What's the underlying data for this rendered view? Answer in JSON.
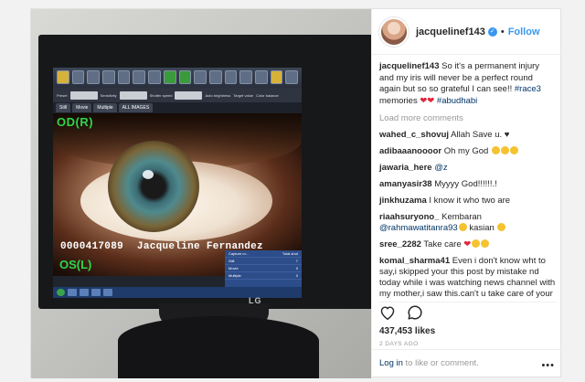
{
  "post": {
    "username": "jacquelinef143",
    "verified_mark": "✓",
    "separator": "•",
    "follow_label": "Follow"
  },
  "photo": {
    "toolbar": {
      "preset_label": "Preset",
      "sensitivity_label": "Sensitivity",
      "shutter_label": "Shutter speed",
      "auto_brightness_label": "Auto brightness",
      "target_value_label": "Target value",
      "color_balance_label": "Color balance"
    },
    "tabs": [
      "Still",
      "Movie",
      "Multiple",
      "ALL IMAGES"
    ],
    "od_label": "OD(R)",
    "os_label": "OS(L)",
    "patient_id": "0000417089",
    "patient_name": "Jacqueline  Fernandez",
    "capture_panel": {
      "header_left": "Capture m...",
      "header_right": "Total shot",
      "rows": [
        {
          "label": "Still",
          "value": "7"
        },
        {
          "label": "Movie",
          "value": "0"
        },
        {
          "label": "Multiple",
          "value": "0"
        }
      ]
    },
    "monitor_brand": "LG"
  },
  "caption": {
    "username": "jacquelinef143",
    "text": " So it's a permanent injury and my iris will never be a perfect round again but so so grateful I can see!! ",
    "hashtag1": "#race3",
    "text2": " memories ",
    "hearts": "❤❤",
    "hashtag2": "#abudhabi"
  },
  "load_more": "Load more comments",
  "comments": [
    {
      "user": "wahed_c_shovuj",
      "text": " Allah Save u. ♥"
    },
    {
      "user": "adibaaanoooor",
      "text": " Oh my God "
    },
    {
      "user": "jawaria_here",
      "text": " ",
      "mention": "@z"
    },
    {
      "user": "amanyasir38",
      "text": " Myyyy God!!!!!!.!"
    },
    {
      "user": "jinkhuzama",
      "text": " I know it who two are"
    },
    {
      "user": "riaahsuryono_",
      "text": " Kembaran ",
      "mention": "@rahmawatitanra93",
      "text2": " kasian "
    },
    {
      "user": "sree_2282",
      "text": " Take care "
    },
    {
      "user": "komal_sharma41",
      "text": " Even i don't know wht to say,i skipped your this post by mistake nd today while i was watching news channel with my mother,i saw this.can't u take care of your self.even i remember while"
    }
  ],
  "likes": "437,453 likes",
  "time_ago": "2 DAYS AGO",
  "login": {
    "link": "Log in",
    "text": " to like or comment."
  },
  "more_menu": "•••"
}
